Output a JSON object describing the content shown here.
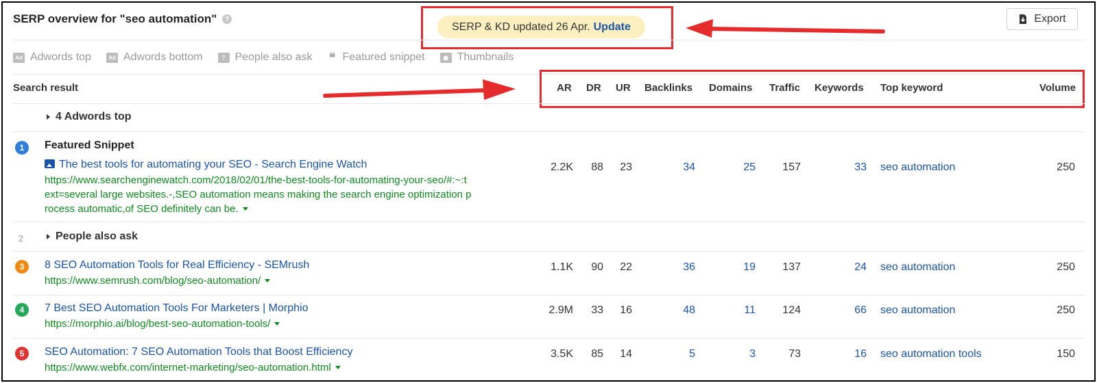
{
  "header": {
    "title": "SERP overview for \"seo automation\"",
    "help_icon": "?",
    "update_text": "SERP & KD updated 26 Apr.",
    "update_link": "Update",
    "export_label": "Export"
  },
  "filters": [
    {
      "label": "Adwords top",
      "icon": "Ad"
    },
    {
      "label": "Adwords bottom",
      "icon": "Ad"
    },
    {
      "label": "People also ask",
      "icon": "?"
    },
    {
      "label": "Featured snippet",
      "icon": "❝"
    },
    {
      "label": "Thumbnails",
      "icon": "▣"
    }
  ],
  "table": {
    "search_result_header": "Search result",
    "columns": [
      "AR",
      "DR",
      "UR",
      "Backlinks",
      "Domains",
      "Traffic",
      "Keywords",
      "Top keyword",
      "Volume"
    ],
    "groups": {
      "adwords_top": "4 Adwords top",
      "people_also_ask": "People also ask",
      "people_also_ask_num": "2"
    },
    "featured_snippet_label": "Featured Snippet",
    "rows": [
      {
        "position": "1",
        "badge_color": "#2f7ed8",
        "title": "The best tools for automating your SEO - Search Engine Watch",
        "url_lines": [
          "https://www.searchenginewatch.com/2018/02/01/the-best-tools-for-automating-your-seo/#:~:t",
          "ext=several large websites.-,SEO automation means making the search engine optimization p",
          "rocess automatic,of SEO definitely can be."
        ],
        "ar": "2.2K",
        "dr": "88",
        "ur": "23",
        "backlinks": "34",
        "domains": "25",
        "traffic": "157",
        "keywords": "33",
        "top_keyword": "seo automation",
        "volume": "250"
      },
      {
        "position": "3",
        "badge_color": "#f08a14",
        "title": "8 SEO Automation Tools for Real Efficiency - SEMrush",
        "url": "https://www.semrush.com/blog/seo-automation/",
        "ar": "1.1K",
        "dr": "90",
        "ur": "22",
        "backlinks": "36",
        "domains": "19",
        "traffic": "137",
        "keywords": "24",
        "top_keyword": "seo automation",
        "volume": "250"
      },
      {
        "position": "4",
        "badge_color": "#25a85a",
        "title": "7 Best SEO Automation Tools For Marketers | Morphio",
        "url": "https://morphio.ai/blog/best-seo-automation-tools/",
        "ar": "2.9M",
        "dr": "33",
        "ur": "16",
        "backlinks": "48",
        "domains": "11",
        "traffic": "124",
        "keywords": "66",
        "top_keyword": "seo automation",
        "volume": "250"
      },
      {
        "position": "5",
        "badge_color": "#e03535",
        "title": "SEO Automation: 7 SEO Automation Tools that Boost Efficiency",
        "url": "https://www.webfx.com/internet-marketing/seo-automation.html",
        "ar": "3.5K",
        "dr": "85",
        "ur": "14",
        "backlinks": "5",
        "domains": "3",
        "traffic": "73",
        "keywords": "16",
        "top_keyword": "seo automation tools",
        "volume": "150"
      }
    ]
  },
  "colors": {
    "annotation_red": "#e52b2b",
    "link_blue": "#1a54a8",
    "url_green": "#0e8a1e",
    "update_bg": "#fcf0c0"
  }
}
